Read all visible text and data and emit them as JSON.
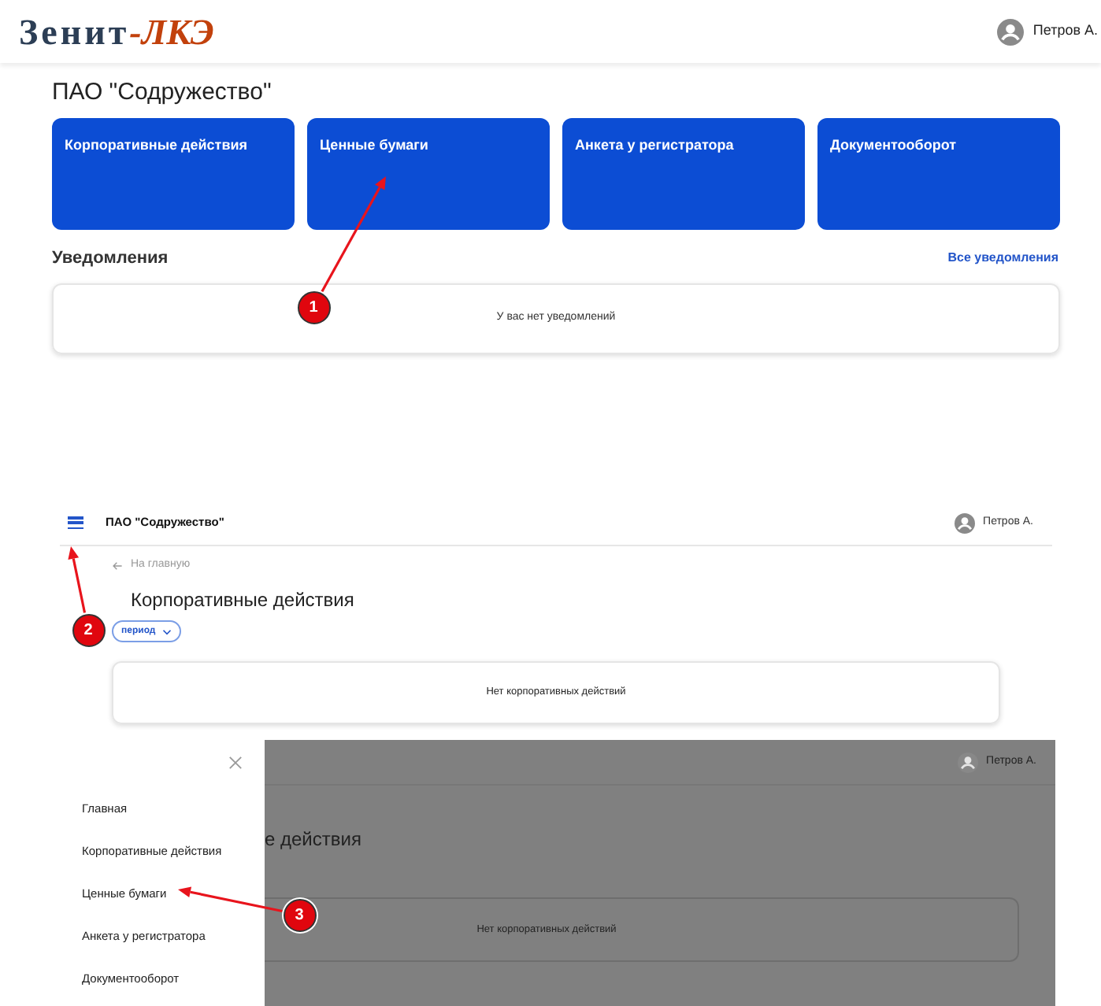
{
  "screen_1": {
    "logo": {
      "part_1": "Зенит",
      "part_2": "-ЛКЭ"
    },
    "user": "Петров А.",
    "company": "ПАО \"Содружество\"",
    "tiles": [
      {
        "label": "Корпоративные действия"
      },
      {
        "label": "Ценные бумаги"
      },
      {
        "label": "Анкета у регистратора"
      },
      {
        "label": "Документооборот"
      }
    ],
    "notifications": {
      "title": "Уведомления",
      "link": "Все уведомления",
      "empty": "У вас нет уведомлений"
    }
  },
  "screen_2": {
    "company": "ПАО \"Содружество\"",
    "user": "Петров А.",
    "back_link": "На главную",
    "title": "Корпоративные действия",
    "filter": "период",
    "empty": "Нет корпоративных действий"
  },
  "screen_3": {
    "menu": [
      {
        "label": "Главная"
      },
      {
        "label": "Корпоративные действия"
      },
      {
        "label": "Ценные бумаги"
      },
      {
        "label": "Анкета у регистратора"
      },
      {
        "label": "Документооборот"
      }
    ],
    "user": "Петров А.",
    "title_partial": "е действия",
    "empty": "Нет корпоративных действий"
  },
  "annotations": [
    {
      "number": "1"
    },
    {
      "number": "2"
    },
    {
      "number": "3"
    }
  ]
}
